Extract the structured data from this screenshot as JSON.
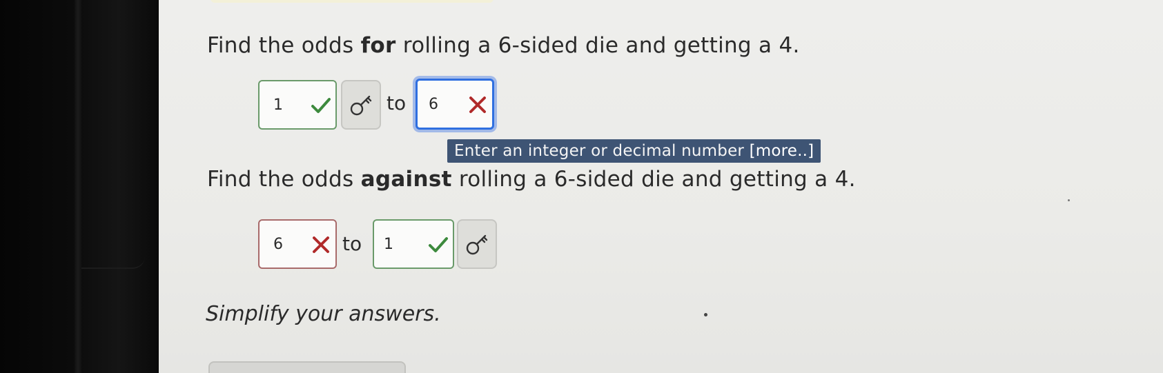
{
  "question1": {
    "prefix": "Find the odds ",
    "emphasis": "for",
    "suffix": " rolling a 6-sided die and getting a 4.",
    "answer_left": {
      "value": "1",
      "status": "correct"
    },
    "connector": "to",
    "answer_right": {
      "value": "6",
      "status": "incorrect"
    }
  },
  "tooltip": {
    "text": "Enter an integer or decimal number ",
    "more": "[more..]"
  },
  "question2": {
    "prefix": "Find the odds ",
    "emphasis": "against",
    "suffix": " rolling a 6-sided die and getting a 4.",
    "answer_left": {
      "value": "6",
      "status": "incorrect"
    },
    "connector": "to",
    "answer_right": {
      "value": "1",
      "status": "correct"
    }
  },
  "instruction": "Simplify your answers.",
  "icons": {
    "correct": "checkmark-icon",
    "incorrect": "x-mark-icon",
    "key": "key-icon"
  },
  "colors": {
    "correct": "#3d8a3d",
    "incorrect": "#b02a2a",
    "focus": "#2f6fe0",
    "tooltip_bg": "#3e5474"
  }
}
